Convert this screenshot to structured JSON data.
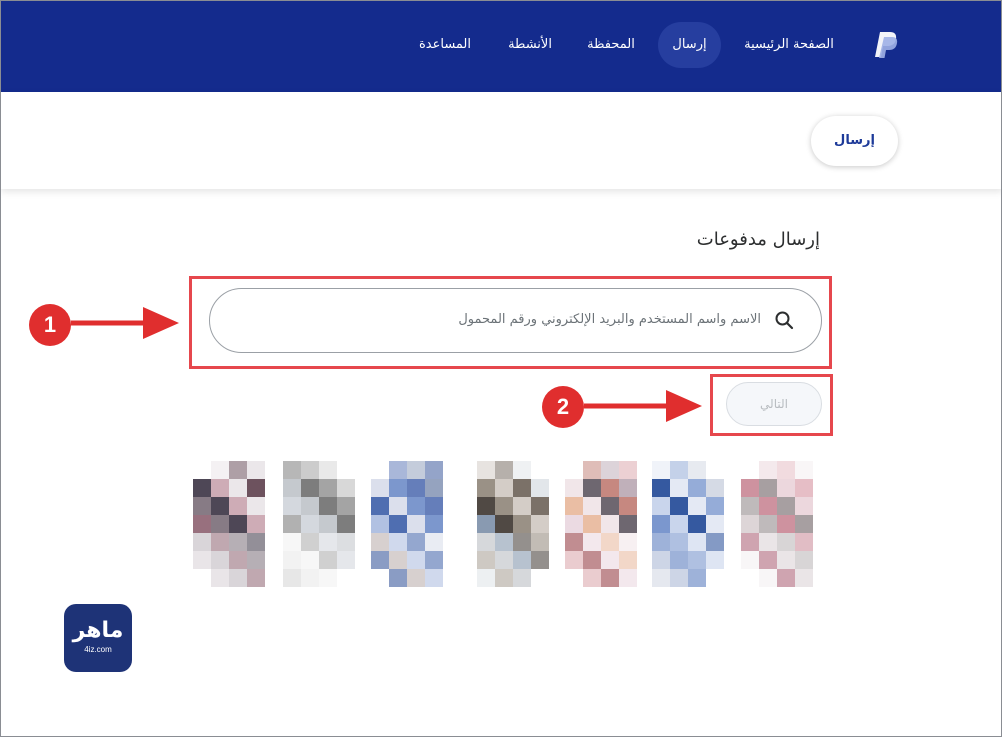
{
  "nav": {
    "logo_icon": "paypal-logo-icon",
    "items": [
      {
        "id": "nav-home",
        "label": "الصفحة الرئيسية",
        "active": false
      },
      {
        "id": "nav-send",
        "label": "إرسال",
        "active": true
      },
      {
        "id": "nav-wallet",
        "label": "المحفظة",
        "active": false
      },
      {
        "id": "nav-activity",
        "label": "الأنشطة",
        "active": false
      },
      {
        "id": "nav-help",
        "label": "المساعدة",
        "active": false
      }
    ]
  },
  "subheader": {
    "send_pill_label": "إرسال"
  },
  "main": {
    "title": "إرسال مدفوعات",
    "search": {
      "placeholder": "الاسم واسم المستخدم والبريد الإلكتروني ورقم المحمول",
      "value": ""
    },
    "next_label": "التالي"
  },
  "annotations": {
    "marker1": "1",
    "marker2": "2"
  },
  "contacts": [
    {
      "id": "contact-1"
    },
    {
      "id": "contact-2"
    },
    {
      "id": "contact-3"
    },
    {
      "id": "contact-4"
    },
    {
      "id": "contact-5"
    },
    {
      "id": "contact-6"
    },
    {
      "id": "contact-7"
    }
  ],
  "watermark": {
    "text": "ماهر",
    "sub": "4iz.com"
  },
  "colors": {
    "nav_bg": "#142b8d",
    "nav_active_bg": "#263e9f",
    "annotation_red": "#e6474d",
    "marker_red": "#e02e2e",
    "watermark_bg": "#1e3377"
  }
}
